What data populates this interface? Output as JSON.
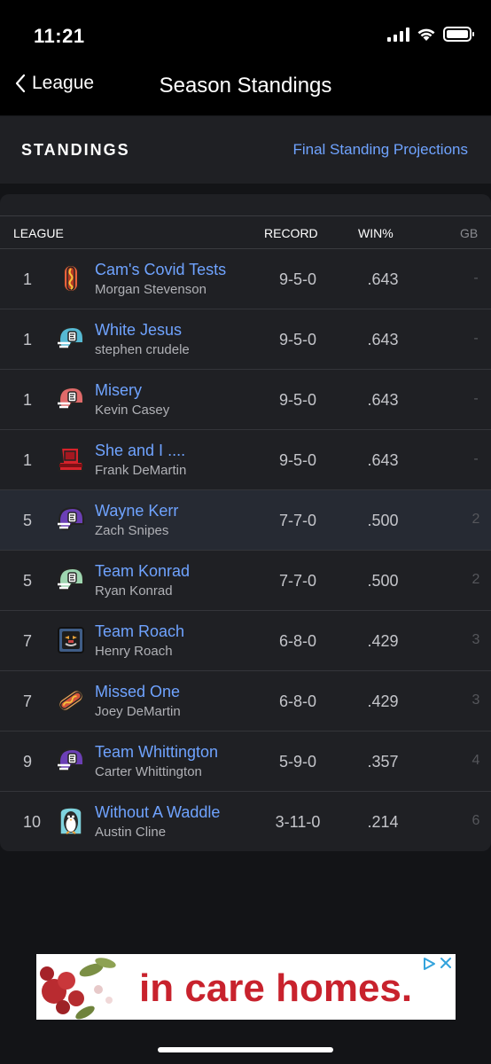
{
  "status": {
    "time": "11:21"
  },
  "nav": {
    "back_label": "League",
    "title": "Season Standings"
  },
  "standings": {
    "title": "STANDINGS",
    "projections_link": "Final Standing Projections"
  },
  "table": {
    "headers": {
      "league": "LEAGUE",
      "record": "RECORD",
      "win_pct": "WIN%",
      "gb": "GB"
    },
    "rows": [
      {
        "rank": "1",
        "team": "Cam's Covid Tests",
        "owner": "Morgan Stevenson",
        "record": "9-5-0",
        "win_pct": ".643",
        "gb": "-",
        "logo": "hotdog-icon"
      },
      {
        "rank": "1",
        "team": "White Jesus",
        "owner": "stephen crudele",
        "record": "9-5-0",
        "win_pct": ".643",
        "gb": "-",
        "logo": "helmet-cyan-icon"
      },
      {
        "rank": "1",
        "team": "Misery",
        "owner": "Kevin Casey",
        "record": "9-5-0",
        "win_pct": ".643",
        "gb": "-",
        "logo": "helmet-red-icon"
      },
      {
        "rank": "1",
        "team": "She and I ....",
        "owner": "Frank DeMartin",
        "record": "9-5-0",
        "win_pct": ".643",
        "gb": "-",
        "logo": "chair-icon"
      },
      {
        "rank": "5",
        "team": "Wayne Kerr",
        "owner": "Zach Snipes",
        "record": "7-7-0",
        "win_pct": ".500",
        "gb": "2",
        "logo": "helmet-purple-icon"
      },
      {
        "rank": "5",
        "team": "Team Konrad",
        "owner": "Ryan Konrad",
        "record": "7-7-0",
        "win_pct": ".500",
        "gb": "2",
        "logo": "helmet-green-icon"
      },
      {
        "rank": "7",
        "team": "Team Roach",
        "owner": "Henry Roach",
        "record": "6-8-0",
        "win_pct": ".429",
        "gb": "3",
        "logo": "mask-icon"
      },
      {
        "rank": "7",
        "team": "Missed One",
        "owner": "Joey DeMartin",
        "record": "6-8-0",
        "win_pct": ".429",
        "gb": "3",
        "logo": "hotdog-bun-icon"
      },
      {
        "rank": "9",
        "team": "Team Whittington",
        "owner": "Carter Whittington",
        "record": "5-9-0",
        "win_pct": ".357",
        "gb": "4",
        "logo": "helmet-purple-icon"
      },
      {
        "rank": "10",
        "team": "Without A Waddle",
        "owner": "Austin Cline",
        "record": "3-11-0",
        "win_pct": ".214",
        "gb": "6",
        "logo": "penguin-icon"
      }
    ],
    "highlight_row": 4
  },
  "ad": {
    "text": "in care homes."
  },
  "colors": {
    "link": "#6fa3ff",
    "background": "#131417",
    "card": "#1f2024",
    "ad_text": "#c8222d"
  }
}
